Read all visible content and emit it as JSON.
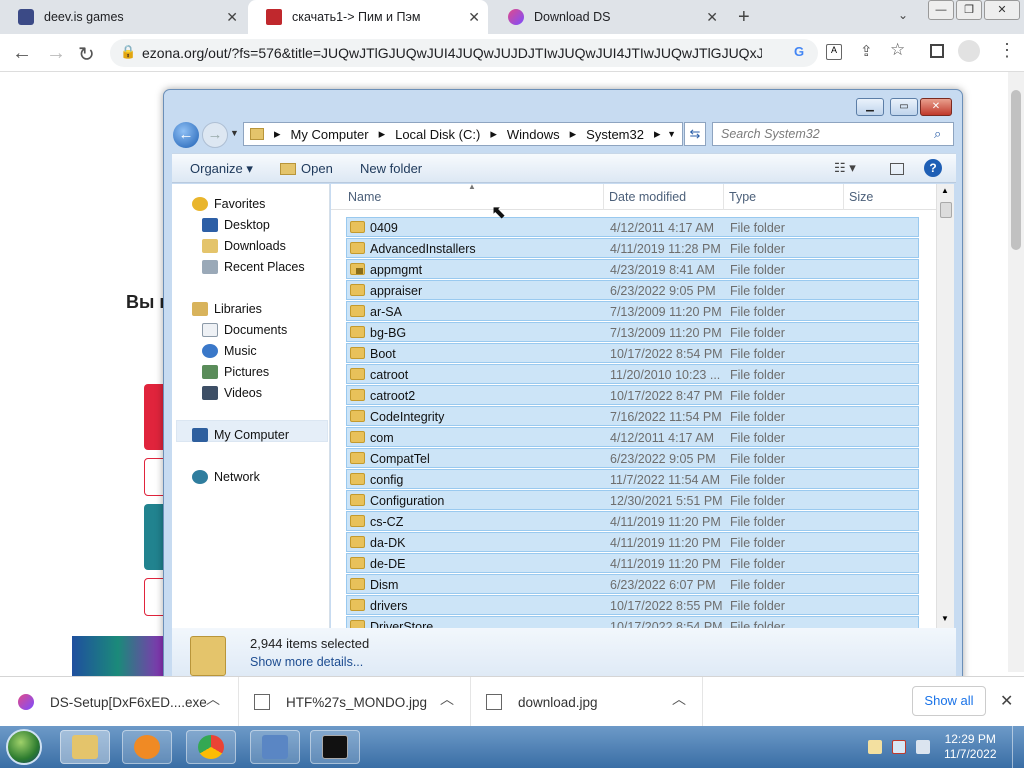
{
  "browser": {
    "tabs": [
      {
        "title": "deev.is games",
        "active": false
      },
      {
        "title": "скачать1-> Пим и Пэм",
        "active": true
      },
      {
        "title": "Download DS",
        "active": false
      }
    ],
    "url": "ezona.org/out/?fs=576&title=JUQwJTlGJUQwJUI4JUQwJUJDJTIwJUQwJUI4JTIwJUQwJTlGJUQxJTheJU..."
  },
  "page": {
    "heading_fragment": "Вы п"
  },
  "explorer": {
    "breadcrumb": [
      "My Computer",
      "Local Disk (C:)",
      "Windows",
      "System32"
    ],
    "search_placeholder": "Search System32",
    "toolbar": {
      "organize": "Organize",
      "open": "Open",
      "new_folder": "New folder"
    },
    "nav": {
      "favorites": "Favorites",
      "desktop": "Desktop",
      "downloads": "Downloads",
      "recent": "Recent Places",
      "libraries": "Libraries",
      "documents": "Documents",
      "music": "Music",
      "pictures": "Pictures",
      "videos": "Videos",
      "my_computer": "My Computer",
      "network": "Network"
    },
    "columns": {
      "name": "Name",
      "date": "Date modified",
      "type": "Type",
      "size": "Size"
    },
    "rows": [
      {
        "name": "0409",
        "date": "4/12/2011 4:17 AM",
        "type": "File folder"
      },
      {
        "name": "AdvancedInstallers",
        "date": "4/11/2019 11:28 PM",
        "type": "File folder"
      },
      {
        "name": "appmgmt",
        "date": "4/23/2019 8:41 AM",
        "type": "File folder"
      },
      {
        "name": "appraiser",
        "date": "6/23/2022 9:05 PM",
        "type": "File folder"
      },
      {
        "name": "ar-SA",
        "date": "7/13/2009 11:20 PM",
        "type": "File folder"
      },
      {
        "name": "bg-BG",
        "date": "7/13/2009 11:20 PM",
        "type": "File folder"
      },
      {
        "name": "Boot",
        "date": "10/17/2022 8:54 PM",
        "type": "File folder"
      },
      {
        "name": "catroot",
        "date": "11/20/2010 10:23 ...",
        "type": "File folder"
      },
      {
        "name": "catroot2",
        "date": "10/17/2022 8:47 PM",
        "type": "File folder"
      },
      {
        "name": "CodeIntegrity",
        "date": "7/16/2022 11:54 PM",
        "type": "File folder"
      },
      {
        "name": "com",
        "date": "4/12/2011 4:17 AM",
        "type": "File folder"
      },
      {
        "name": "CompatTel",
        "date": "6/23/2022 9:05 PM",
        "type": "File folder"
      },
      {
        "name": "config",
        "date": "11/7/2022 11:54 AM",
        "type": "File folder"
      },
      {
        "name": "Configuration",
        "date": "12/30/2021 5:51 PM",
        "type": "File folder"
      },
      {
        "name": "cs-CZ",
        "date": "4/11/2019 11:20 PM",
        "type": "File folder"
      },
      {
        "name": "da-DK",
        "date": "4/11/2019 11:20 PM",
        "type": "File folder"
      },
      {
        "name": "de-DE",
        "date": "4/11/2019 11:20 PM",
        "type": "File folder"
      },
      {
        "name": "Dism",
        "date": "6/23/2022 6:07 PM",
        "type": "File folder"
      },
      {
        "name": "drivers",
        "date": "10/17/2022 8:55 PM",
        "type": "File folder"
      },
      {
        "name": "DriverStore",
        "date": "10/17/2022 8:54 PM",
        "type": "File folder"
      }
    ],
    "status": {
      "count": "2,944 items selected",
      "more": "Show more details..."
    }
  },
  "downloads": {
    "items": [
      "DS-Setup[DxF6xED....exe",
      "HTF%27s_MONDO.jpg",
      "download.jpg"
    ],
    "show_all": "Show all"
  },
  "taskbar": {
    "time": "12:29 PM",
    "date": "11/7/2022"
  }
}
